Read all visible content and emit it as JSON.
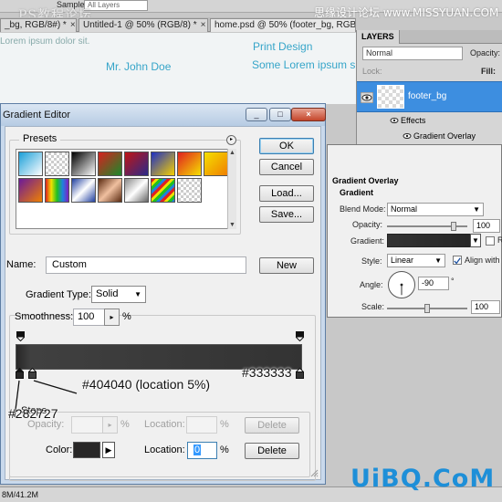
{
  "watermarks": {
    "top_left": "PS教程论坛",
    "top_left_sub": "XX  COM",
    "top_right": "思缘设计论坛 www.MISSYUAN.COM",
    "bottom_right": "UiBQ.CoM"
  },
  "ps_toolbar": {
    "sample_label": "Sample:",
    "sample_value": "All Layers"
  },
  "document_tabs": [
    {
      "label": "_bg, RGB/8#) *",
      "close": "×"
    },
    {
      "label": "Untitled-1 @ 50% (RGB/8) *",
      "close": "×"
    },
    {
      "label": "home.psd @ 50% (footer_bg, RGB/8#) *",
      "close": "×"
    }
  ],
  "canvas": {
    "lorem": "Lorem ipsum dolor sit.",
    "name": "Mr. John Doe",
    "lorem2": "Some Lorem ipsum s",
    "print": "Print Design"
  },
  "layers_panel": {
    "tab": "LAYERS",
    "blend_mode": "Normal",
    "opacity_label": "Opacity:",
    "lock_label": "Lock:",
    "fill_label": "Fill:",
    "layer_name": "footer_bg",
    "effects_label": "Effects",
    "effect_item": "Gradient Overlay"
  },
  "layer_style": {
    "heading": "Gradient Overlay",
    "subheading": "Gradient",
    "blend_mode_label": "Blend Mode:",
    "blend_mode_value": "Normal",
    "opacity_label": "Opacity:",
    "opacity_value": "100",
    "gradient_label": "Gradient:",
    "reverse_label": "R",
    "style_label": "Style:",
    "style_value": "Linear",
    "align_label": "Align with",
    "angle_label": "Angle:",
    "angle_value": "-90",
    "angle_unit": "°",
    "scale_label": "Scale:",
    "scale_value": "100",
    "opacity_level": 0.85,
    "scale_level": 0.5
  },
  "gradient_editor": {
    "title": "Gradient Editor",
    "titlebar_buttons": [
      "_",
      "□",
      "×"
    ],
    "presets_label": "Presets",
    "presets_menu_icon": "▸",
    "buttons": {
      "ok": "OK",
      "cancel": "Cancel",
      "load": "Load...",
      "save": "Save...",
      "new": "New"
    },
    "name_label": "Name:",
    "name_value": "Custom",
    "gradient_type_label": "Gradient Type:",
    "gradient_type_value": "Solid",
    "smoothness_label": "Smoothness:",
    "smoothness_value": "100",
    "smoothness_unit": "%",
    "stops": {
      "group_label": "Stops",
      "opacity_label": "Opacity:",
      "opacity_unit": "%",
      "location_label": "Location:",
      "location_unit": "%",
      "delete_label": "Delete",
      "color_label": "Color:",
      "color_location_label": "Location:",
      "color_location_value": "0",
      "color_location_unit": "%",
      "color_delete_label": "Delete"
    },
    "gradient_colors": {
      "start": "#282727",
      "mid": "#404040",
      "end": "#333333"
    }
  },
  "annotations": {
    "start_color": "#282727",
    "mid_color": "#404040 (location 5%)",
    "end_color": "#333333"
  },
  "statusbar": {
    "doc": "8M/41.2M"
  }
}
